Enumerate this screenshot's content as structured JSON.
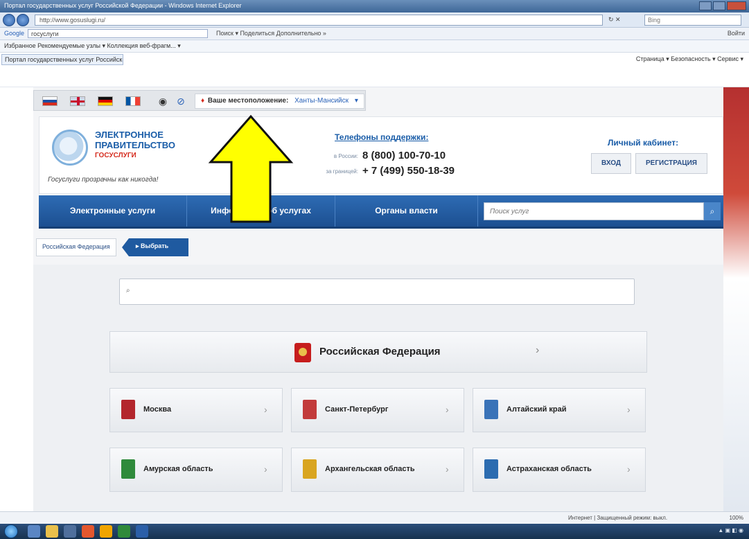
{
  "browser": {
    "title": "Портал государственных услуг Российской Федерации - Windows Internet Explorer",
    "address": "http://www.gosuslugi.ru/",
    "search_engine": "Bing",
    "google_label": "Google",
    "google_query": "госуслуги",
    "google_tools": "Поиск ▾   Поделиться   Дополнительно »",
    "google_right": "Войти",
    "favorites": "Избранное   Рекомендуемые узлы ▾   Коллекция веб-фрагм... ▾",
    "tab_title": "Портал государственных услуг Российской Фе...",
    "command_bar": "Страница ▾   Безопасность ▾   Сервис ▾",
    "status_zone": "Интернет | Защищенный режим: выкл.",
    "zoom": "100%"
  },
  "topbar": {
    "location_label": "Ваше местоположение:",
    "location_city": "Ханты-Мансийск"
  },
  "header": {
    "logo_line1": "ЭЛЕКТРОННОЕ",
    "logo_line2": "ПРАВИТЕЛЬСТВО",
    "logo_sub": "ГОСУСЛУГИ",
    "slogan": "Госуслуги прозрачны как никогда!",
    "support_title": "Телефоны поддержки:",
    "phone_ru_label": "в России:",
    "phone_ru": "8 (800) 100-70-10",
    "phone_abroad_label": "за границей:",
    "phone_abroad": "+ 7 (499) 550-18-39",
    "cabinet_title": "Личный кабинет:",
    "login": "ВХОД",
    "register": "РЕГИСТРАЦИЯ"
  },
  "nav": {
    "items": [
      "Электронные услуги",
      "Информация об услугах",
      "Органы власти"
    ],
    "search_placeholder": "Поиск услуг"
  },
  "breadcrumb": {
    "home": "Российская Федерация",
    "select": "▸ Выбрать"
  },
  "regions": {
    "search_placeholder": "",
    "country": "Российская Федерация",
    "list": [
      {
        "name": "Москва",
        "color": "#b3262d"
      },
      {
        "name": "Санкт-Петербург",
        "color": "#c23b3b"
      },
      {
        "name": "Алтайский край",
        "color": "#3a73b8"
      },
      {
        "name": "Амурская область",
        "color": "#2f8a3b"
      },
      {
        "name": "Архангельская область",
        "color": "#d9a520"
      },
      {
        "name": "Астраханская область",
        "color": "#2c6cb0"
      }
    ]
  },
  "colors": {
    "nav_blue": "#1f5aa0",
    "accent_red": "#d52b1e",
    "arrow_yellow": "#ffff00"
  }
}
